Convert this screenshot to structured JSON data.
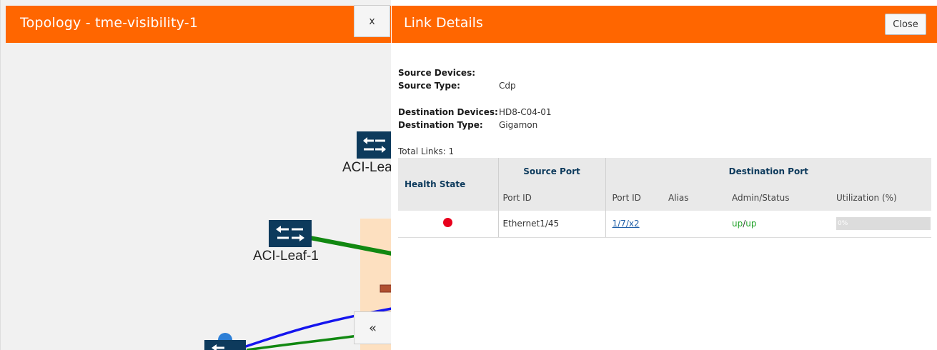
{
  "topology": {
    "title": "Topology - tme-visibility-1",
    "close_label": "x",
    "collapse_label": "«",
    "nodes": [
      {
        "label": "ACI-Leaf"
      },
      {
        "label": "ACI-Leaf-1"
      }
    ]
  },
  "details": {
    "title": "Link Details",
    "close_label": "Close",
    "source_devices_key": "Source Devices:",
    "source_devices_value": "",
    "source_type_key": "Source Type:",
    "source_type_value": "Cdp",
    "destination_devices_key": "Destination Devices:",
    "destination_devices_value": "HD8-C04-01",
    "destination_type_key": "Destination Type:",
    "destination_type_value": "Gigamon",
    "total_links": "Total Links: 1",
    "table": {
      "health_state": "Health State",
      "source_port_group": "Source Port",
      "destination_port_group": "Destination Port",
      "source_port_id": "Port ID",
      "dest_port_id": "Port ID",
      "alias": "Alias",
      "admin_status": "Admin/Status",
      "utilization": "Utilization (%)",
      "rows": [
        {
          "health": "red",
          "source_port": "Ethernet1/45",
          "dest_port": "1/7/x2",
          "alias": "",
          "admin": "up",
          "separator": "/",
          "status": "up",
          "utilization": "0%",
          "utilization_fraction": 0
        }
      ]
    }
  },
  "colors": {
    "header": "#ff6600",
    "switch": "#0d3a5c",
    "link_green": "#118811",
    "link_blue": "#1515ee",
    "health_red": "#e8001c",
    "status_up": "#22a22a"
  }
}
